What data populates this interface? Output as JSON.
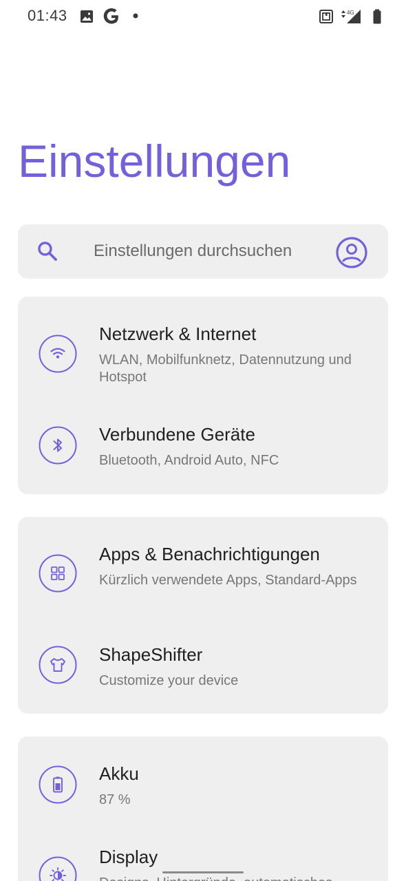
{
  "status_bar": {
    "time": "01:43",
    "icons_left": [
      "image-icon",
      "google-g-icon",
      "notification-dot-icon"
    ],
    "icons_right": [
      "nfc-icon",
      "signal-4g-icon",
      "battery-icon"
    ],
    "network_label": "4G"
  },
  "page": {
    "title": "Einstellungen"
  },
  "search": {
    "placeholder": "Einstellungen durchsuchen"
  },
  "accent_color": "#7460dc",
  "cards": [
    {
      "items": [
        {
          "title": "Netzwerk & Internet",
          "subtitle": "WLAN, Mobilfunknetz, Datennutzung und Hotspot",
          "icon": "wifi-icon"
        },
        {
          "title": "Verbundene Geräte",
          "subtitle": "Bluetooth, Android Auto, NFC",
          "icon": "bluetooth-icon"
        }
      ]
    },
    {
      "items": [
        {
          "title": "Apps & Benachrichtigungen",
          "subtitle": "Kürzlich verwendete Apps, Standard-Apps",
          "icon": "apps-grid-icon"
        },
        {
          "title": "ShapeShifter",
          "subtitle": "Customize your device",
          "icon": "tshirt-icon"
        }
      ]
    },
    {
      "items": [
        {
          "title": "Akku",
          "subtitle": "87 %",
          "icon": "battery-icon"
        },
        {
          "title": "Display",
          "subtitle": "Designs, Hintergründe, automatisches",
          "icon": "brightness-icon"
        }
      ]
    }
  ]
}
